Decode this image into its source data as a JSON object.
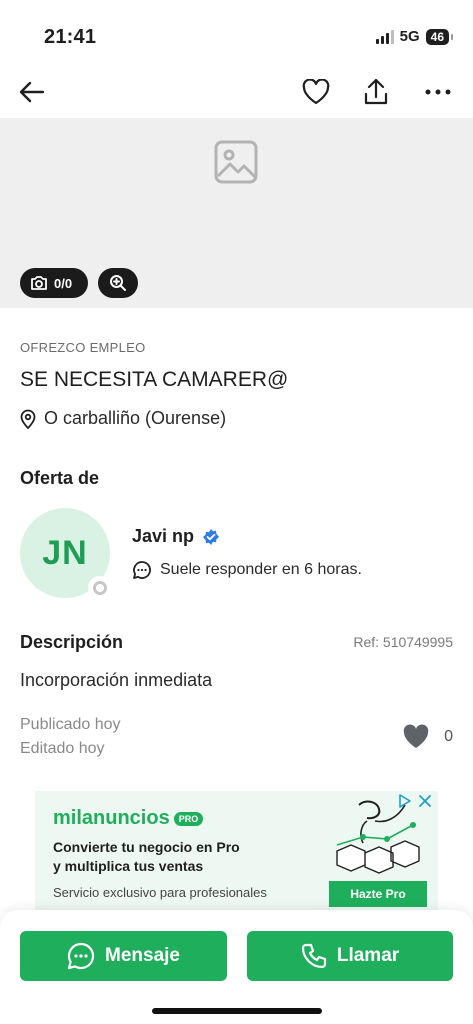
{
  "status": {
    "time": "21:41",
    "network": "5G",
    "battery": "46"
  },
  "hero": {
    "photo_count": "0/0"
  },
  "listing": {
    "category": "OFREZCO EMPLEO",
    "title": "SE NECESITA CAMARER@",
    "location": "O carballiño (Ourense)"
  },
  "seller": {
    "section_title": "Oferta de",
    "initials": "JN",
    "name": "Javi np",
    "response": "Suele responder en 6 horas."
  },
  "description": {
    "section_title": "Descripción",
    "ref": "Ref: 510749995",
    "text": "Incorporación inmediata",
    "published": "Publicado hoy",
    "edited": "Editado hoy",
    "likes": "0"
  },
  "ad": {
    "brand": "milanuncios",
    "badge": "PRO",
    "line1": "Convierte tu negocio en Pro",
    "line2": "y multiplica tus ventas",
    "subline": "Servicio exclusivo para profesionales",
    "cta": "Hazte Pro"
  },
  "actions": {
    "message": "Mensaje",
    "call": "Llamar"
  },
  "colors": {
    "accent": "#1faf5c",
    "avatar_bg": "#d9f2e3",
    "hero_bg": "#efefef",
    "verified": "#2d7be5"
  },
  "icons": {
    "back": "arrow-left-icon",
    "favorite": "heart-icon",
    "share": "share-icon",
    "more": "more-icon",
    "placeholder": "image-placeholder-icon",
    "camera": "camera-icon",
    "zoom": "zoom-icon",
    "location": "location-pin-icon",
    "verified": "verified-badge-icon",
    "chat": "chat-bubble-icon",
    "like": "heart-filled-icon",
    "phone": "phone-icon"
  }
}
